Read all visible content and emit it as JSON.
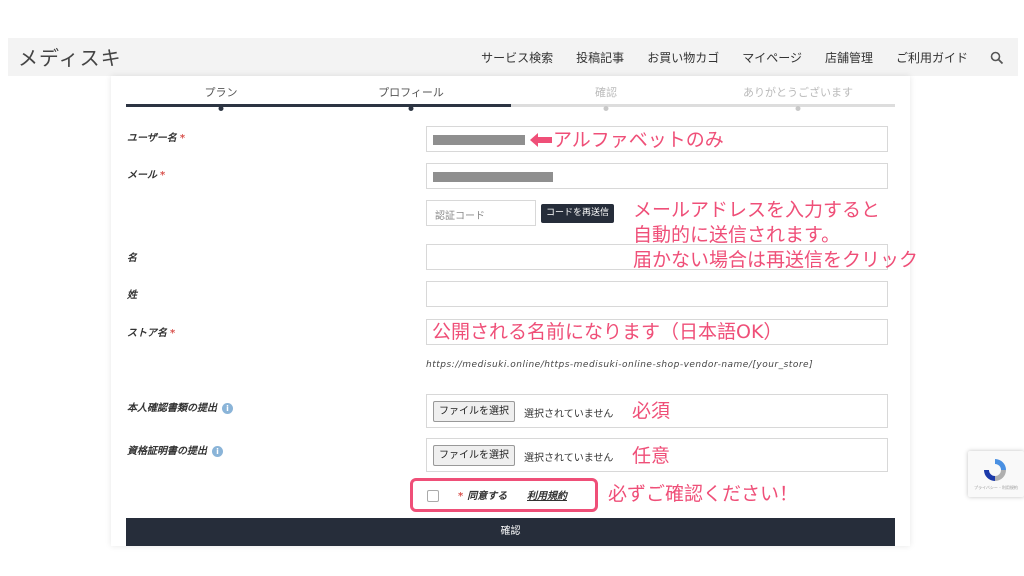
{
  "header": {
    "site_title": "メディスキ",
    "nav": [
      "サービス検索",
      "投稿記事",
      "お買い物カゴ",
      "マイページ",
      "店舗管理",
      "ご利用ガイド"
    ]
  },
  "steps": {
    "labels": [
      "プラン",
      "プロフィール",
      "確認",
      "ありがとうございます"
    ],
    "current_step": 2,
    "progress_fraction": 0.5
  },
  "form": {
    "username_label": "ユーザー名",
    "email_label": "メール",
    "code_placeholder": "認証コード",
    "resend_button": "コードを再送信",
    "first_name_label": "名",
    "last_name_label": "姓",
    "store_name_label": "ストア名",
    "store_url": "https://medisuki.online/https-medisuki-online-shop-vendor-name/[your_store]",
    "id_doc_label": "本人確認書類の提出",
    "license_doc_label": "資格証明書の提出",
    "file_button": "ファイルを選択",
    "file_status": "選択されていません",
    "agree_label": "同意する",
    "terms_link": "利用規約",
    "confirm_button": "確認",
    "required_mark": "*",
    "info_mark": "i"
  },
  "annotations": {
    "username": "アルファベットのみ",
    "email_line1": "メールアドレスを入力すると",
    "email_line2": "自動的に送信されます。",
    "email_line3": "届かない場合は再送信をクリック",
    "store_name": "公開される名前になります（日本語OK）",
    "id_doc": "必須",
    "license_doc": "任意",
    "agree": "必ずご確認ください！"
  },
  "recaptcha": {
    "footer": "プライバシー - 利用規約"
  },
  "colors": {
    "accent_pink": "#ef4f78",
    "button_dark": "#262d3a",
    "required_red": "#d9534f"
  },
  "icons": [
    "search-icon",
    "left-arrow-icon",
    "info-icon",
    "recaptcha-icon"
  ]
}
